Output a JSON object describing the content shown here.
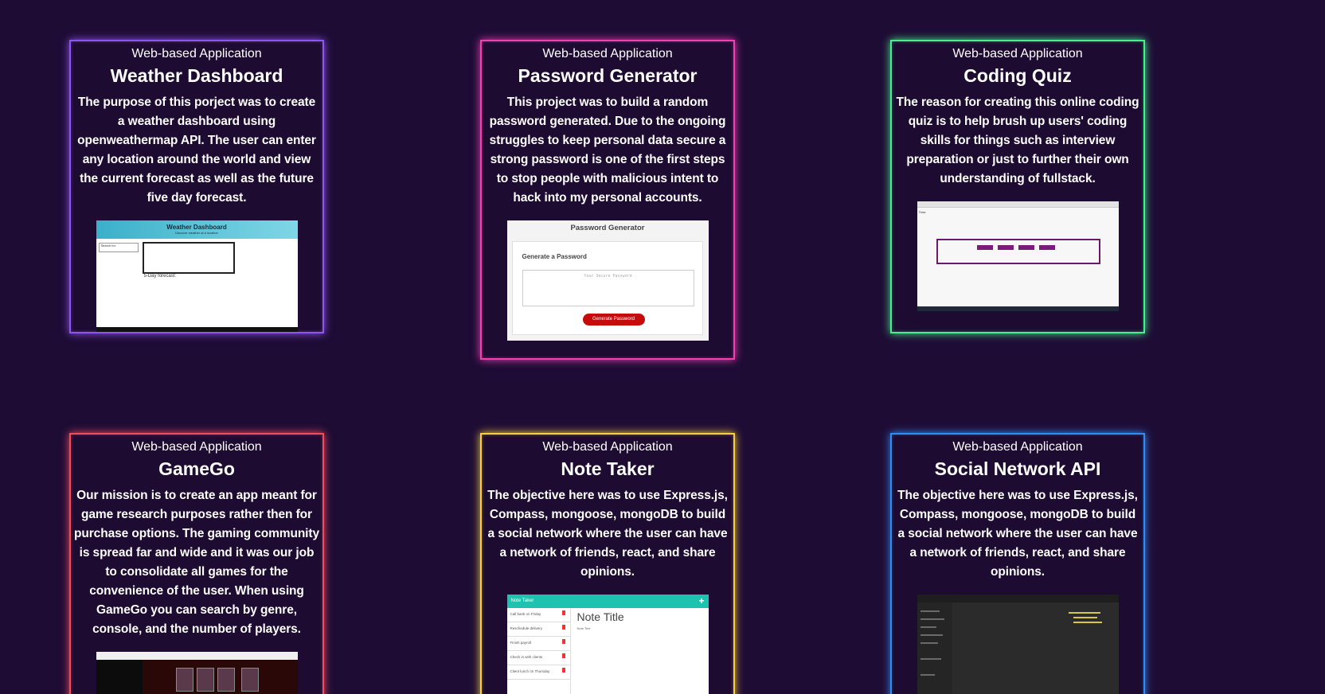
{
  "cards": [
    {
      "kind": "Web-based Application",
      "title": "Weather Dashboard",
      "desc": "The purpose of this porject was to create a weather dashboard using openweathermap API. The user can enter any location around the world and view the current forecast as well as the future five day forecast.",
      "shot": {
        "header": "Weather Dashboard",
        "subheader": "Discover weather at a location",
        "search": "Search for:",
        "forecast": "5-Day forecast:"
      }
    },
    {
      "kind": "Web-based Application",
      "title": "Password Generator",
      "desc": "This project was to build a random password generated. Due to the ongoing struggles to keep personal data secure a strong password is one of the first steps to stop people with malicious intent to hack into my personal accounts.",
      "shot": {
        "header": "Password Generator",
        "subheader": "Generate a Password",
        "placeholder": "Your Secure Password",
        "button": "Generate Password"
      }
    },
    {
      "kind": "Web-based Application",
      "title": "Coding Quiz",
      "desc": "The reason for creating this online coding quiz is to help brush up users' coding skills for things such as interview preparation or just to further their own understanding of fullstack.",
      "shot": {
        "timer": "Time:"
      }
    },
    {
      "kind": "Web-based Application",
      "title": "GameGo",
      "desc": "Our mission is to create an app meant for game research purposes rather then for purchase options. The gaming community is spread far and wide and it was our job to consolidate all games for the convenience of the user. When using GameGo you can search by genre, console, and the number of players.",
      "shot": {}
    },
    {
      "kind": "Web-based Application",
      "title": "Note Taker",
      "desc": "The objective here was to use Express.js, Compass, mongoose, mongoDB to build a social network where the user can have a network of friends, react, and share opinions.",
      "shot": {
        "header": "Note Taker",
        "items": [
          "Call bank on Friday",
          "Reschedule delivery",
          "Finish payroll",
          "Check in with clients",
          "Client lunch on Thursday"
        ],
        "note_title": "Note Title",
        "note_text": "Note Text"
      }
    },
    {
      "kind": "Web-based Application",
      "title": "Social Network API",
      "desc": "The objective here was to use Express.js, Compass, mongoose, mongoDB to build a social network where the user can have a network of friends, react, and share opinions.",
      "shot": {}
    }
  ],
  "colors": {
    "background": "#1e0c35",
    "purple": "#8f55ee",
    "pink": "#f23fb2",
    "green": "#47f08a",
    "red": "#f24d5c",
    "yellow": "#f6d03e",
    "blue": "#2f8ef6"
  }
}
